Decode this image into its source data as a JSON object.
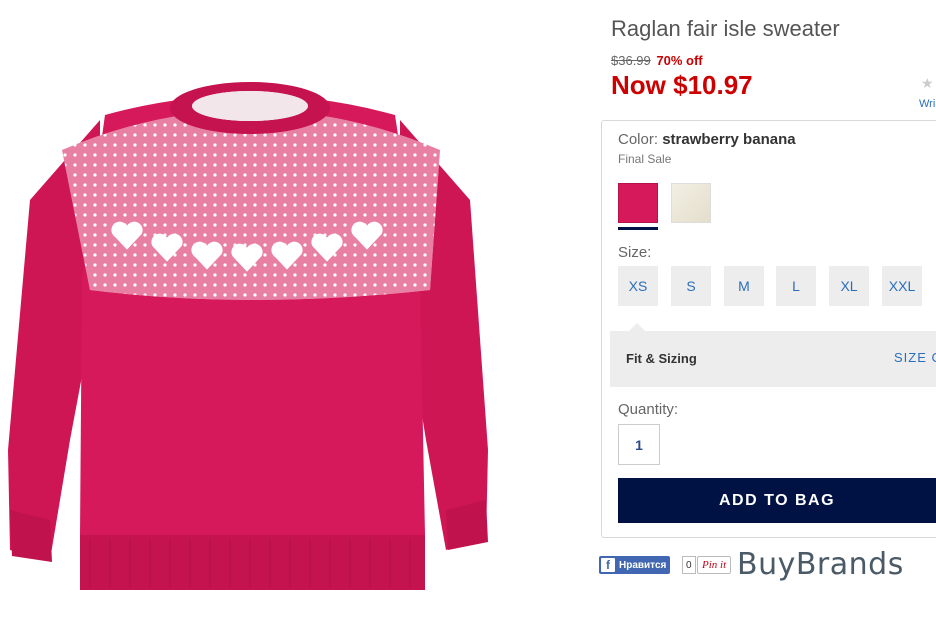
{
  "product": {
    "title": "Raglan fair isle sweater",
    "original_price": "$36.99",
    "discount": "70% off",
    "now_price": "Now $10.97",
    "rating_glyph": "★",
    "write_review_stub": "Wri"
  },
  "color": {
    "label": "Color:",
    "selected": "strawberry banana",
    "note": "Final Sale",
    "swatches": [
      {
        "name": "strawberry banana",
        "hex": "#d5195a",
        "selected": true
      },
      {
        "name": "cream",
        "hex": "#efebdc",
        "selected": false
      }
    ]
  },
  "size": {
    "label": "Size:",
    "options": [
      "XS",
      "S",
      "M",
      "L",
      "XL",
      "XXL"
    ]
  },
  "fit": {
    "label": "Fit & Sizing",
    "size_chart_link": "SIZE C"
  },
  "quantity": {
    "label": "Quantity:",
    "value": "1"
  },
  "add_to_bag": "ADD TO BAG",
  "social": {
    "fb_icon": "f",
    "fb_like": "Нравится",
    "fb_count": "0",
    "pin_label": "Pin it"
  },
  "watermark": "BuyBrands",
  "colors": {
    "sale_red": "#cc0000",
    "navy": "#001244",
    "link_blue": "#2a6ebb",
    "sweater_pink": "#d5195a"
  }
}
